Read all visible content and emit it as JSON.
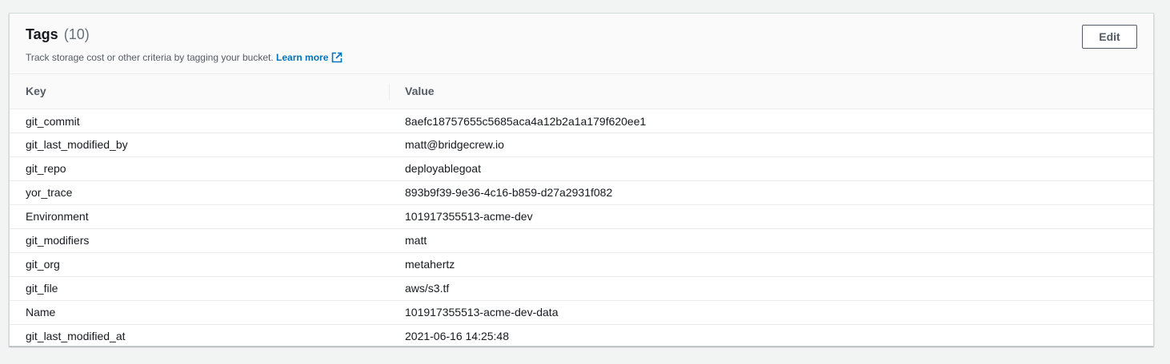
{
  "panel": {
    "title": "Tags",
    "count": "(10)",
    "description": "Track storage cost or other criteria by tagging your bucket.",
    "learn_more": "Learn more",
    "edit_label": "Edit"
  },
  "table": {
    "headers": {
      "key": "Key",
      "value": "Value"
    },
    "rows": [
      {
        "key": "git_commit",
        "value": "8aefc18757655c5685aca4a12b2a1a179f620ee1"
      },
      {
        "key": "git_last_modified_by",
        "value": "matt@bridgecrew.io"
      },
      {
        "key": "git_repo",
        "value": "deployablegoat"
      },
      {
        "key": "yor_trace",
        "value": "893b9f39-9e36-4c16-b859-d27a2931f082"
      },
      {
        "key": "Environment",
        "value": "101917355513-acme-dev"
      },
      {
        "key": "git_modifiers",
        "value": "matt"
      },
      {
        "key": "git_org",
        "value": "metahertz"
      },
      {
        "key": "git_file",
        "value": "aws/s3.tf"
      },
      {
        "key": "Name",
        "value": "101917355513-acme-dev-data"
      },
      {
        "key": "git_last_modified_at",
        "value": "2021-06-16 14:25:48"
      }
    ]
  },
  "colors": {
    "link": "#0073bb",
    "text": "#16191f",
    "muted": "#545b64",
    "background": "#f2f3f3"
  },
  "icons": {
    "learn_more": "external-link-icon"
  }
}
